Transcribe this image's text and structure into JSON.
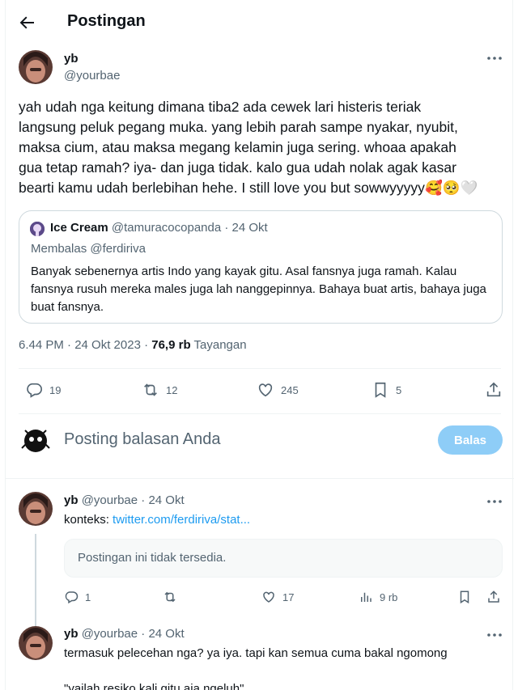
{
  "header": {
    "title": "Postingan",
    "back_icon": "arrow-left-icon"
  },
  "post": {
    "name": "yb",
    "handle": "@yourbae",
    "text": "yah udah nga keitung dimana tiba2 ada cewek lari histeris teriak\nlangsung peluk pegang muka. yang lebih parah sampe nyakar, nyubit,\nmaksa cium, atau maksa megang kelamin juga sering. whoaa apakah\ngua tetap ramah? iya- dan juga tidak. kalo gua udah nolak agak kasar\nbearti kamu udah berlebihan hehe. I still love you but sowwyyyyy",
    "emoji": "🥰🥺🤍",
    "quote": {
      "name": "Ice Cream",
      "handle": "@tamuracocopanda",
      "date": "· 24 Okt",
      "reply_to": "Membalas @ferdiriva",
      "text": "Banyak sebenernya artis Indo yang kayak gitu. Asal fansnya juga ramah. Kalau fansnya rusuh mereka males juga lah nanggepinnya. Bahaya buat artis, bahaya juga buat fansnya."
    },
    "time": "6.44 PM · 24 Okt 2023 · ",
    "views_count": "76,9 rb",
    "views_label": "Tayangan",
    "stats": {
      "replies": "19",
      "reposts": "12",
      "likes": "245",
      "bookmarks": "5"
    }
  },
  "reply_box": {
    "placeholder": "Posting balasan Anda",
    "button": "Balas"
  },
  "replies": [
    {
      "name": "yb",
      "handle": "@yourbae",
      "date": "· 24 Okt",
      "prefix": "konteks: ",
      "link": "twitter.com/ferdiriva/stat...",
      "unavailable": "Postingan ini tidak tersedia.",
      "stats": {
        "replies": "1",
        "reposts": "",
        "likes": "17",
        "views": "9 rb"
      }
    },
    {
      "name": "yb",
      "handle": "@yourbae",
      "date": "· 24 Okt",
      "text_line1": "termasuk pelecehan nga? ya iya. tapi kan semua cuma bakal ngomong",
      "text_line2": "\"yailah resiko kali gitu aja ngeluh\""
    }
  ],
  "colors": {
    "accent": "#1d9bf0",
    "button_disabled": "#8ecdf7",
    "muted": "#536471",
    "border": "#cfd9de"
  }
}
